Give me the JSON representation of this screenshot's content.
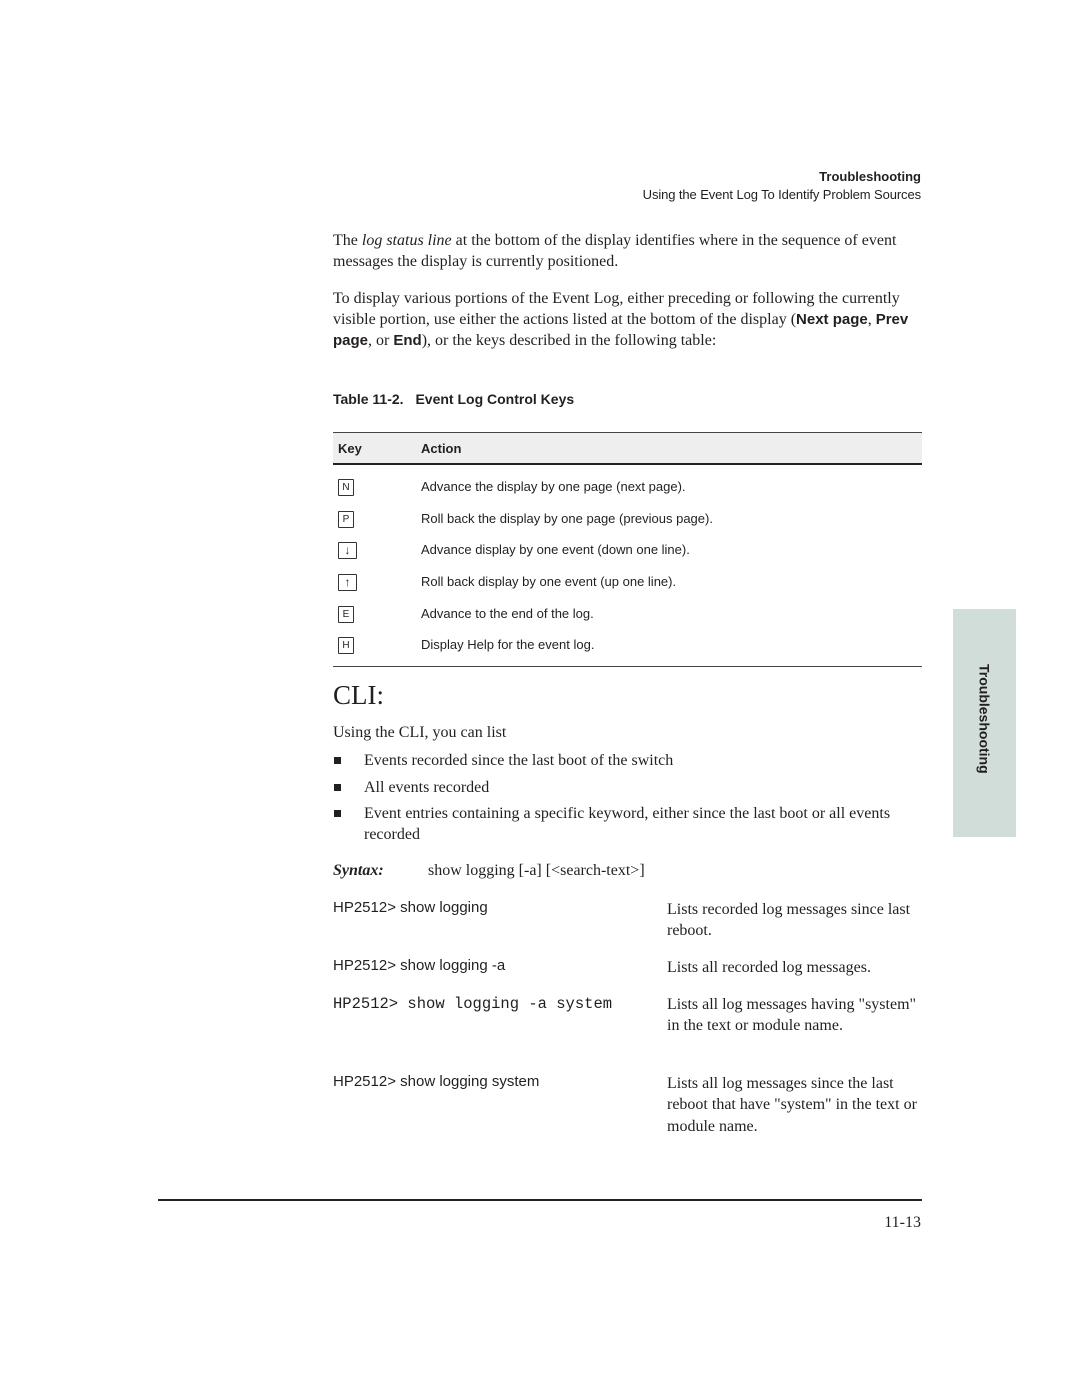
{
  "header": {
    "section": "Troubleshooting",
    "subsection": "Using the Event Log To Identify Problem Sources"
  },
  "paragraphs": {
    "p1": {
      "before": "The ",
      "italic": "log status line",
      "after": " at the bottom of the display identifies where in the sequence of event messages the display is currently positioned."
    },
    "p2": {
      "t1": "To display various portions of the Event Log, either preceding or following the currently visible portion, use either the actions listed at the bottom of the display (",
      "b1": "Next page",
      "t2": ", ",
      "b2": "Prev page",
      "t3": ", or ",
      "b3": "End",
      "t4": "), or the keys described in the following table:"
    }
  },
  "table": {
    "caption_number": "Table 11-2.",
    "caption_title": "Event Log Control Keys",
    "headers": {
      "key": "Key",
      "action": "Action"
    },
    "rows": [
      {
        "key": "N",
        "icon": "n-key-icon",
        "action": "Advance the display by one page (next page)."
      },
      {
        "key": "P",
        "icon": "p-key-icon",
        "action": "Roll back the display by one page (previous page)."
      },
      {
        "key": "↓",
        "icon": "down-arrow-key-icon",
        "action": "Advance display by one event (down one line)."
      },
      {
        "key": "↑",
        "icon": "up-arrow-key-icon",
        "action": "Roll back display by one event (up one line)."
      },
      {
        "key": "E",
        "icon": "e-key-icon",
        "action": "Advance to the end of the log."
      },
      {
        "key": "H",
        "icon": "h-key-icon",
        "action": "Display Help for the event log."
      }
    ]
  },
  "cli": {
    "heading": "CLI:",
    "intro": "Using the CLI, you can list",
    "bullets": [
      "Events recorded since the last boot of the switch",
      "All events recorded",
      "Event entries containing a specific keyword, either since the last boot or all events recorded"
    ],
    "syntax_label": "Syntax:",
    "syntax_text": "show logging [-a] [<search-text>]",
    "examples": [
      {
        "command": "HP2512> show logging",
        "description": "Lists recorded log messages since last reboot."
      },
      {
        "command": "HP2512> show logging -a",
        "description": "Lists all recorded log messages."
      },
      {
        "command": "HP2512> show logging -a system",
        "description": "Lists all log messages having \"system\" in the text or module name."
      },
      {
        "command": "HP2512> show logging system",
        "description": "Lists all log messages since the last reboot that have \"system\" in the text or module name."
      }
    ]
  },
  "footer": {
    "page_number": "11-13"
  },
  "side_tab": {
    "label": "Troubleshooting",
    "color": "#d1ddd8"
  }
}
